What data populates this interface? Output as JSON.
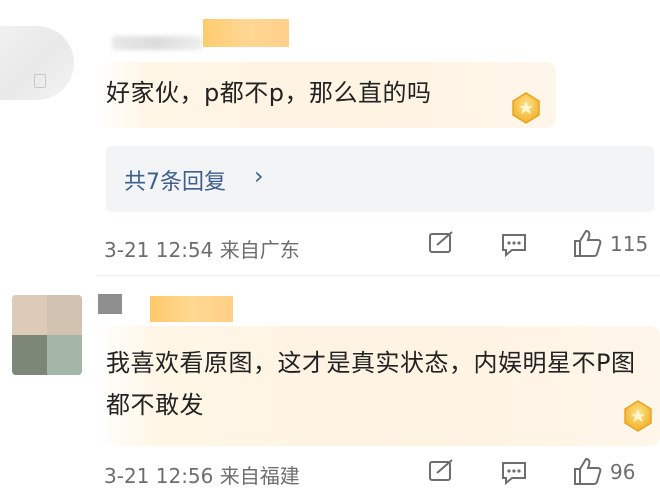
{
  "comments": [
    {
      "text": "好家伙，p都不p，那么直的吗",
      "replies_label": "共7条回复",
      "meta": "3-21 12:54 来自广东",
      "likes": "115"
    },
    {
      "text": "我喜欢看原图，这才是真实状态，内娱明星不P图都不敢发",
      "meta": "3-21 12:56 来自福建",
      "likes": "96"
    }
  ],
  "icons": [
    "avatar",
    "share-icon",
    "comment-icon",
    "like-icon",
    "badge-icon",
    "chevron-right-icon"
  ],
  "colors": {
    "link_blue": "#3e5f8c",
    "meta_gray": "#6e6e6e",
    "highlight_bg": "#fff3e2",
    "reply_bg": "#f3f4f6"
  }
}
